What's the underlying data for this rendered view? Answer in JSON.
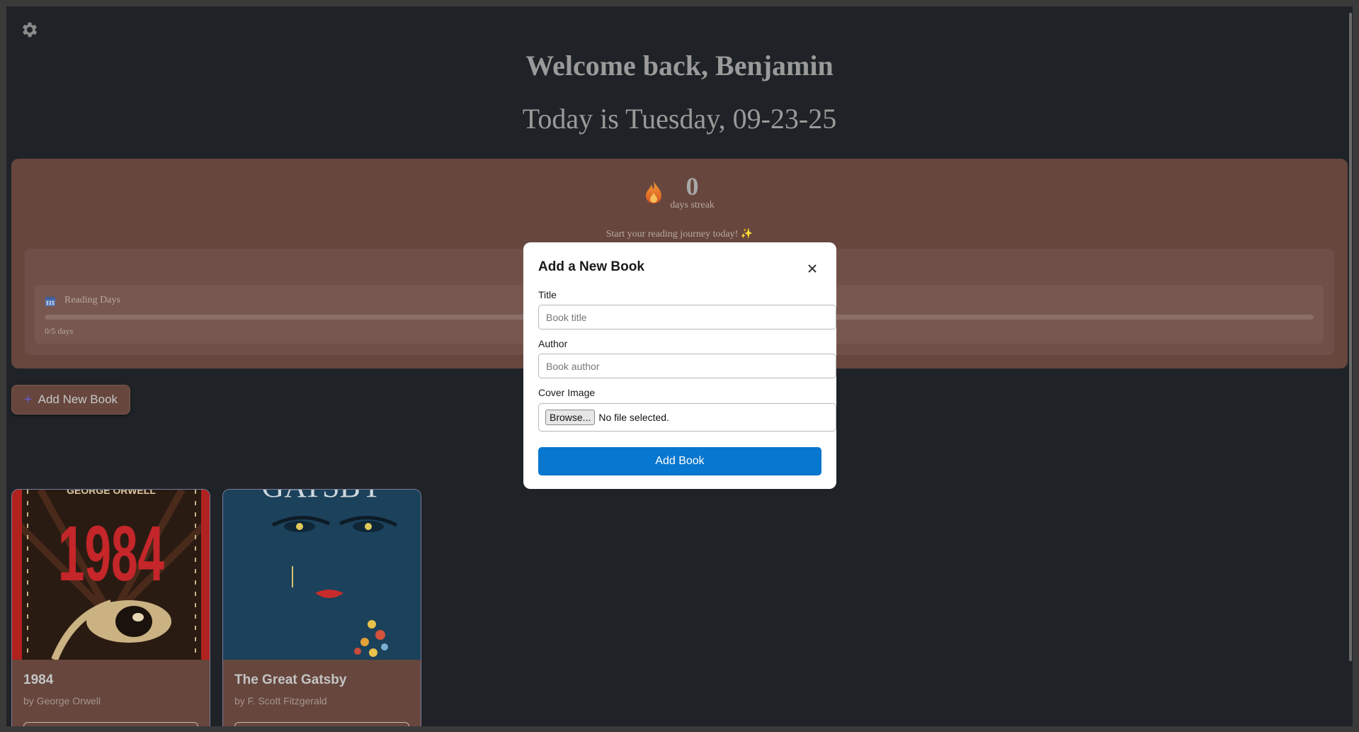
{
  "header": {
    "welcome": "Welcome back, Benjamin",
    "today": "Today is Tuesday, 09-23-25"
  },
  "streak": {
    "count": "0",
    "label": "days streak",
    "message": "Start your reading journey today! ✨"
  },
  "reading_days": {
    "label": "Reading Days",
    "progress_text": "0/5 days",
    "progress_fraction": 0
  },
  "actions": {
    "add_new_book": "Add New Book"
  },
  "books": [
    {
      "title": "1984",
      "author": "by George Orwell",
      "cover_text": "1984",
      "cover_top": "GEORGE ORWELL"
    },
    {
      "title": "The Great Gatsby",
      "author": "by F. Scott Fitzgerald",
      "cover_top": "GATSBY"
    }
  ],
  "modal": {
    "title": "Add a New Book",
    "title_label": "Title",
    "title_placeholder": "Book title",
    "author_label": "Author",
    "author_placeholder": "Book author",
    "cover_label": "Cover Image",
    "browse_label": "Browse...",
    "no_file": "No file selected.",
    "submit_label": "Add Book"
  },
  "colors": {
    "background": "#1f2327",
    "panel": "#66463d",
    "accent": "#0877cf"
  }
}
